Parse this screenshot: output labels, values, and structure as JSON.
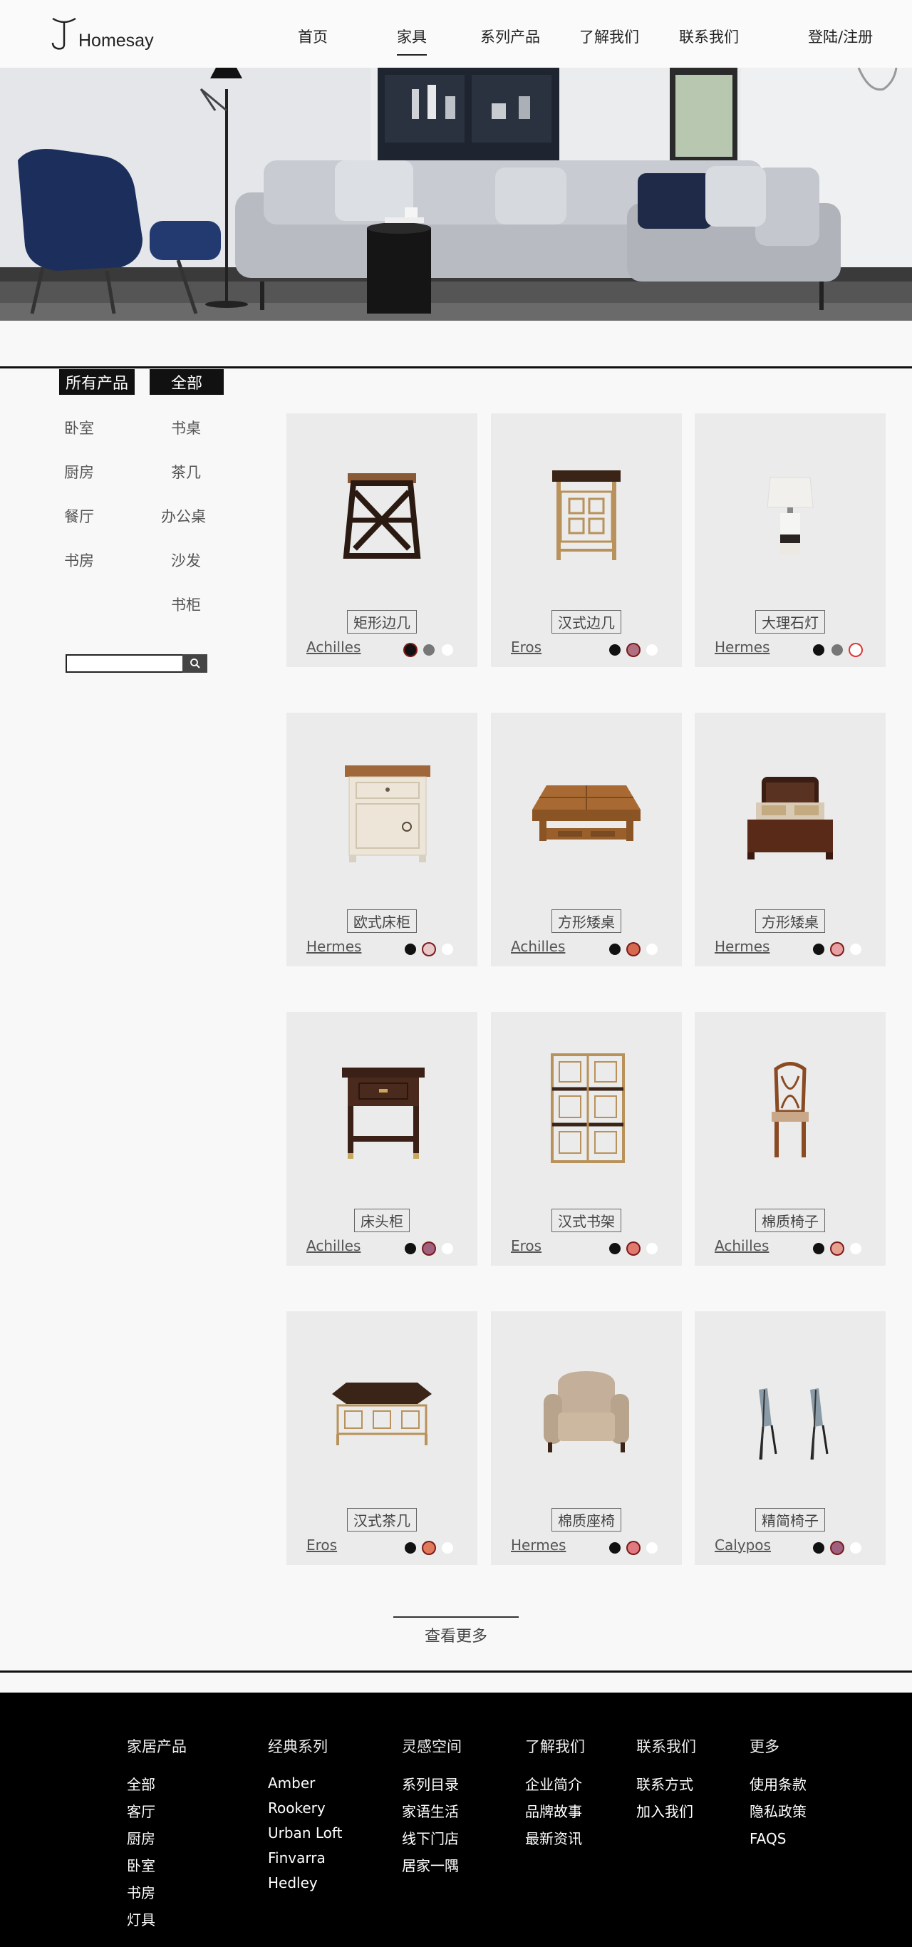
{
  "brand": {
    "name": "Homesay"
  },
  "nav": {
    "home": "首页",
    "furniture": "家具",
    "series": "系列产品",
    "about": "了解我们",
    "contact": "联系我们",
    "login": "登陆/注册"
  },
  "sidebar": {
    "all_products": "所有产品",
    "all": "全部",
    "categories_left": [
      "卧室",
      "厨房",
      "餐厅",
      "书房"
    ],
    "categories_right": [
      "书桌",
      "茶几",
      "办公桌",
      "沙发",
      "书柜"
    ],
    "search_placeholder": ""
  },
  "products": [
    {
      "name": "矩形边几",
      "brand": "Achilles",
      "colors": [
        "#111111",
        "#777777",
        "#ffffff"
      ],
      "selected": 0
    },
    {
      "name": "汉式边几",
      "brand": "Eros",
      "colors": [
        "#111111",
        "#b07080",
        "#ffffff"
      ],
      "selected": 1
    },
    {
      "name": "大理石灯",
      "brand": "Hermes",
      "colors": [
        "#111111",
        "#777777",
        "#ffffff"
      ],
      "selected": 2
    },
    {
      "name": "欧式床柜",
      "brand": "Hermes",
      "colors": [
        "#111111",
        "#e8c8c8",
        "#ffffff"
      ],
      "selected": 1
    },
    {
      "name": "方形矮桌",
      "brand": "Achilles",
      "colors": [
        "#111111",
        "#d56a50",
        "#ffffff"
      ],
      "selected": 1
    },
    {
      "name": "方形矮桌",
      "brand": "Hermes",
      "colors": [
        "#111111",
        "#e8a0a0",
        "#ffffff"
      ],
      "selected": 1
    },
    {
      "name": "床头柜",
      "brand": "Achilles",
      "colors": [
        "#111111",
        "#a06080",
        "#ffffff"
      ],
      "selected": 1
    },
    {
      "name": "汉式书架",
      "brand": "Eros",
      "colors": [
        "#111111",
        "#e07a70",
        "#ffffff"
      ],
      "selected": 1
    },
    {
      "name": "棉质椅子",
      "brand": "Achilles",
      "colors": [
        "#111111",
        "#e8a090",
        "#ffffff"
      ],
      "selected": 1
    },
    {
      "name": "汉式茶几",
      "brand": "Eros",
      "colors": [
        "#111111",
        "#e07a5a",
        "#ffffff"
      ],
      "selected": 1
    },
    {
      "name": "棉质座椅",
      "brand": "Hermes",
      "colors": [
        "#111111",
        "#e07a80",
        "#ffffff"
      ],
      "selected": 1
    },
    {
      "name": "精简椅子",
      "brand": "Calypos",
      "colors": [
        "#111111",
        "#a06080",
        "#ffffff"
      ],
      "selected": 1
    }
  ],
  "more": {
    "label": "查看更多"
  },
  "footer": [
    {
      "title": "家居产品",
      "items": [
        "全部",
        "客厅",
        "厨房",
        "卧室",
        "书房",
        "灯具"
      ]
    },
    {
      "title": "经典系列",
      "items": [
        "Amber",
        "Rookery",
        "Urban Loft",
        "Finvarra",
        "Hedley"
      ]
    },
    {
      "title": "灵感空间",
      "items": [
        "系列目录",
        "家语生活",
        "线下门店",
        "居家一隅"
      ]
    },
    {
      "title": "了解我们",
      "items": [
        "企业简介",
        "品牌故事",
        "最新资讯"
      ]
    },
    {
      "title": "联系我们",
      "items": [
        "联系方式",
        "加入我们"
      ]
    },
    {
      "title": "更多",
      "items": [
        "使用条款",
        "隐私政策",
        "FAQS"
      ]
    }
  ]
}
